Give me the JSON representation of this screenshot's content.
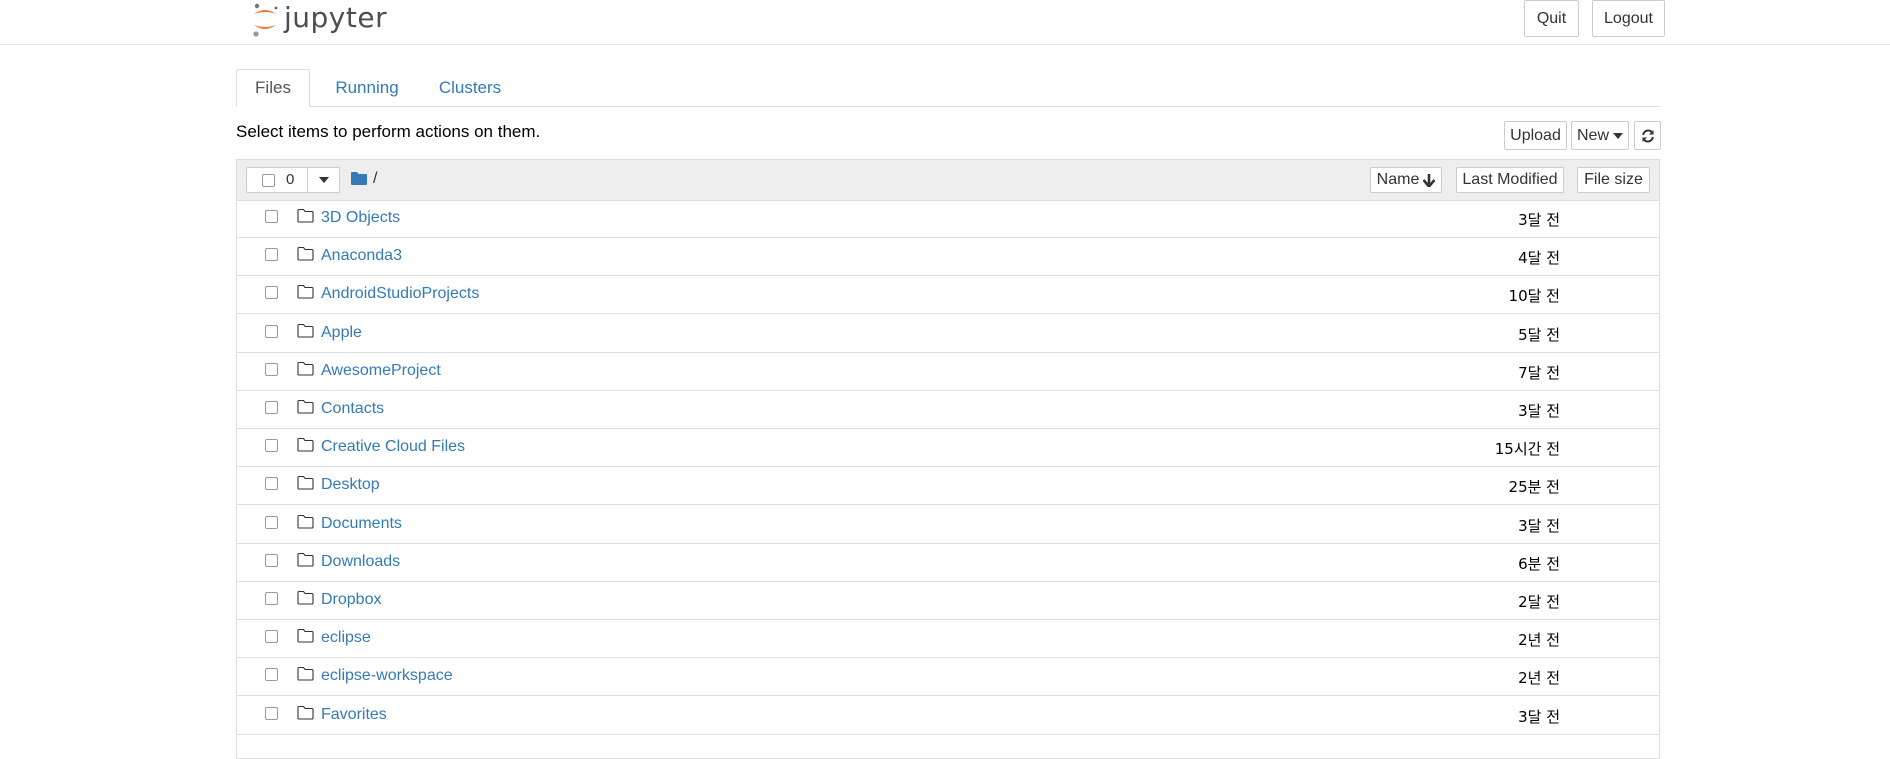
{
  "header": {
    "logo_text": "jupyter",
    "quit_label": "Quit",
    "logout_label": "Logout"
  },
  "tabs": [
    {
      "label": "Files",
      "active": true
    },
    {
      "label": "Running",
      "active": false
    },
    {
      "label": "Clusters",
      "active": false
    }
  ],
  "toolbar": {
    "select_message": "Select items to perform actions on them.",
    "upload_label": "Upload",
    "new_label": "New",
    "refresh_icon": "refresh-icon"
  },
  "list_header": {
    "selected_count": "0",
    "path": "/",
    "sort_name_label": "Name",
    "last_modified_label": "Last Modified",
    "file_size_label": "File size"
  },
  "items": [
    {
      "name": "3D Objects",
      "modified": "3달 전"
    },
    {
      "name": "Anaconda3",
      "modified": "4달 전"
    },
    {
      "name": "AndroidStudioProjects",
      "modified": "10달 전"
    },
    {
      "name": "Apple",
      "modified": "5달 전"
    },
    {
      "name": "AwesomeProject",
      "modified": "7달 전"
    },
    {
      "name": "Contacts",
      "modified": "3달 전"
    },
    {
      "name": "Creative Cloud Files",
      "modified": "15시간 전"
    },
    {
      "name": "Desktop",
      "modified": "25분 전"
    },
    {
      "name": "Documents",
      "modified": "3달 전"
    },
    {
      "name": "Downloads",
      "modified": "6분 전"
    },
    {
      "name": "Dropbox",
      "modified": "2달 전"
    },
    {
      "name": "eclipse",
      "modified": "2년 전"
    },
    {
      "name": "eclipse-workspace",
      "modified": "2년 전"
    },
    {
      "name": "Favorites",
      "modified": "3달 전"
    }
  ],
  "colors": {
    "link": "#337ab7",
    "logo_orange": "#f37726",
    "header_gray": "#eeeeee"
  }
}
